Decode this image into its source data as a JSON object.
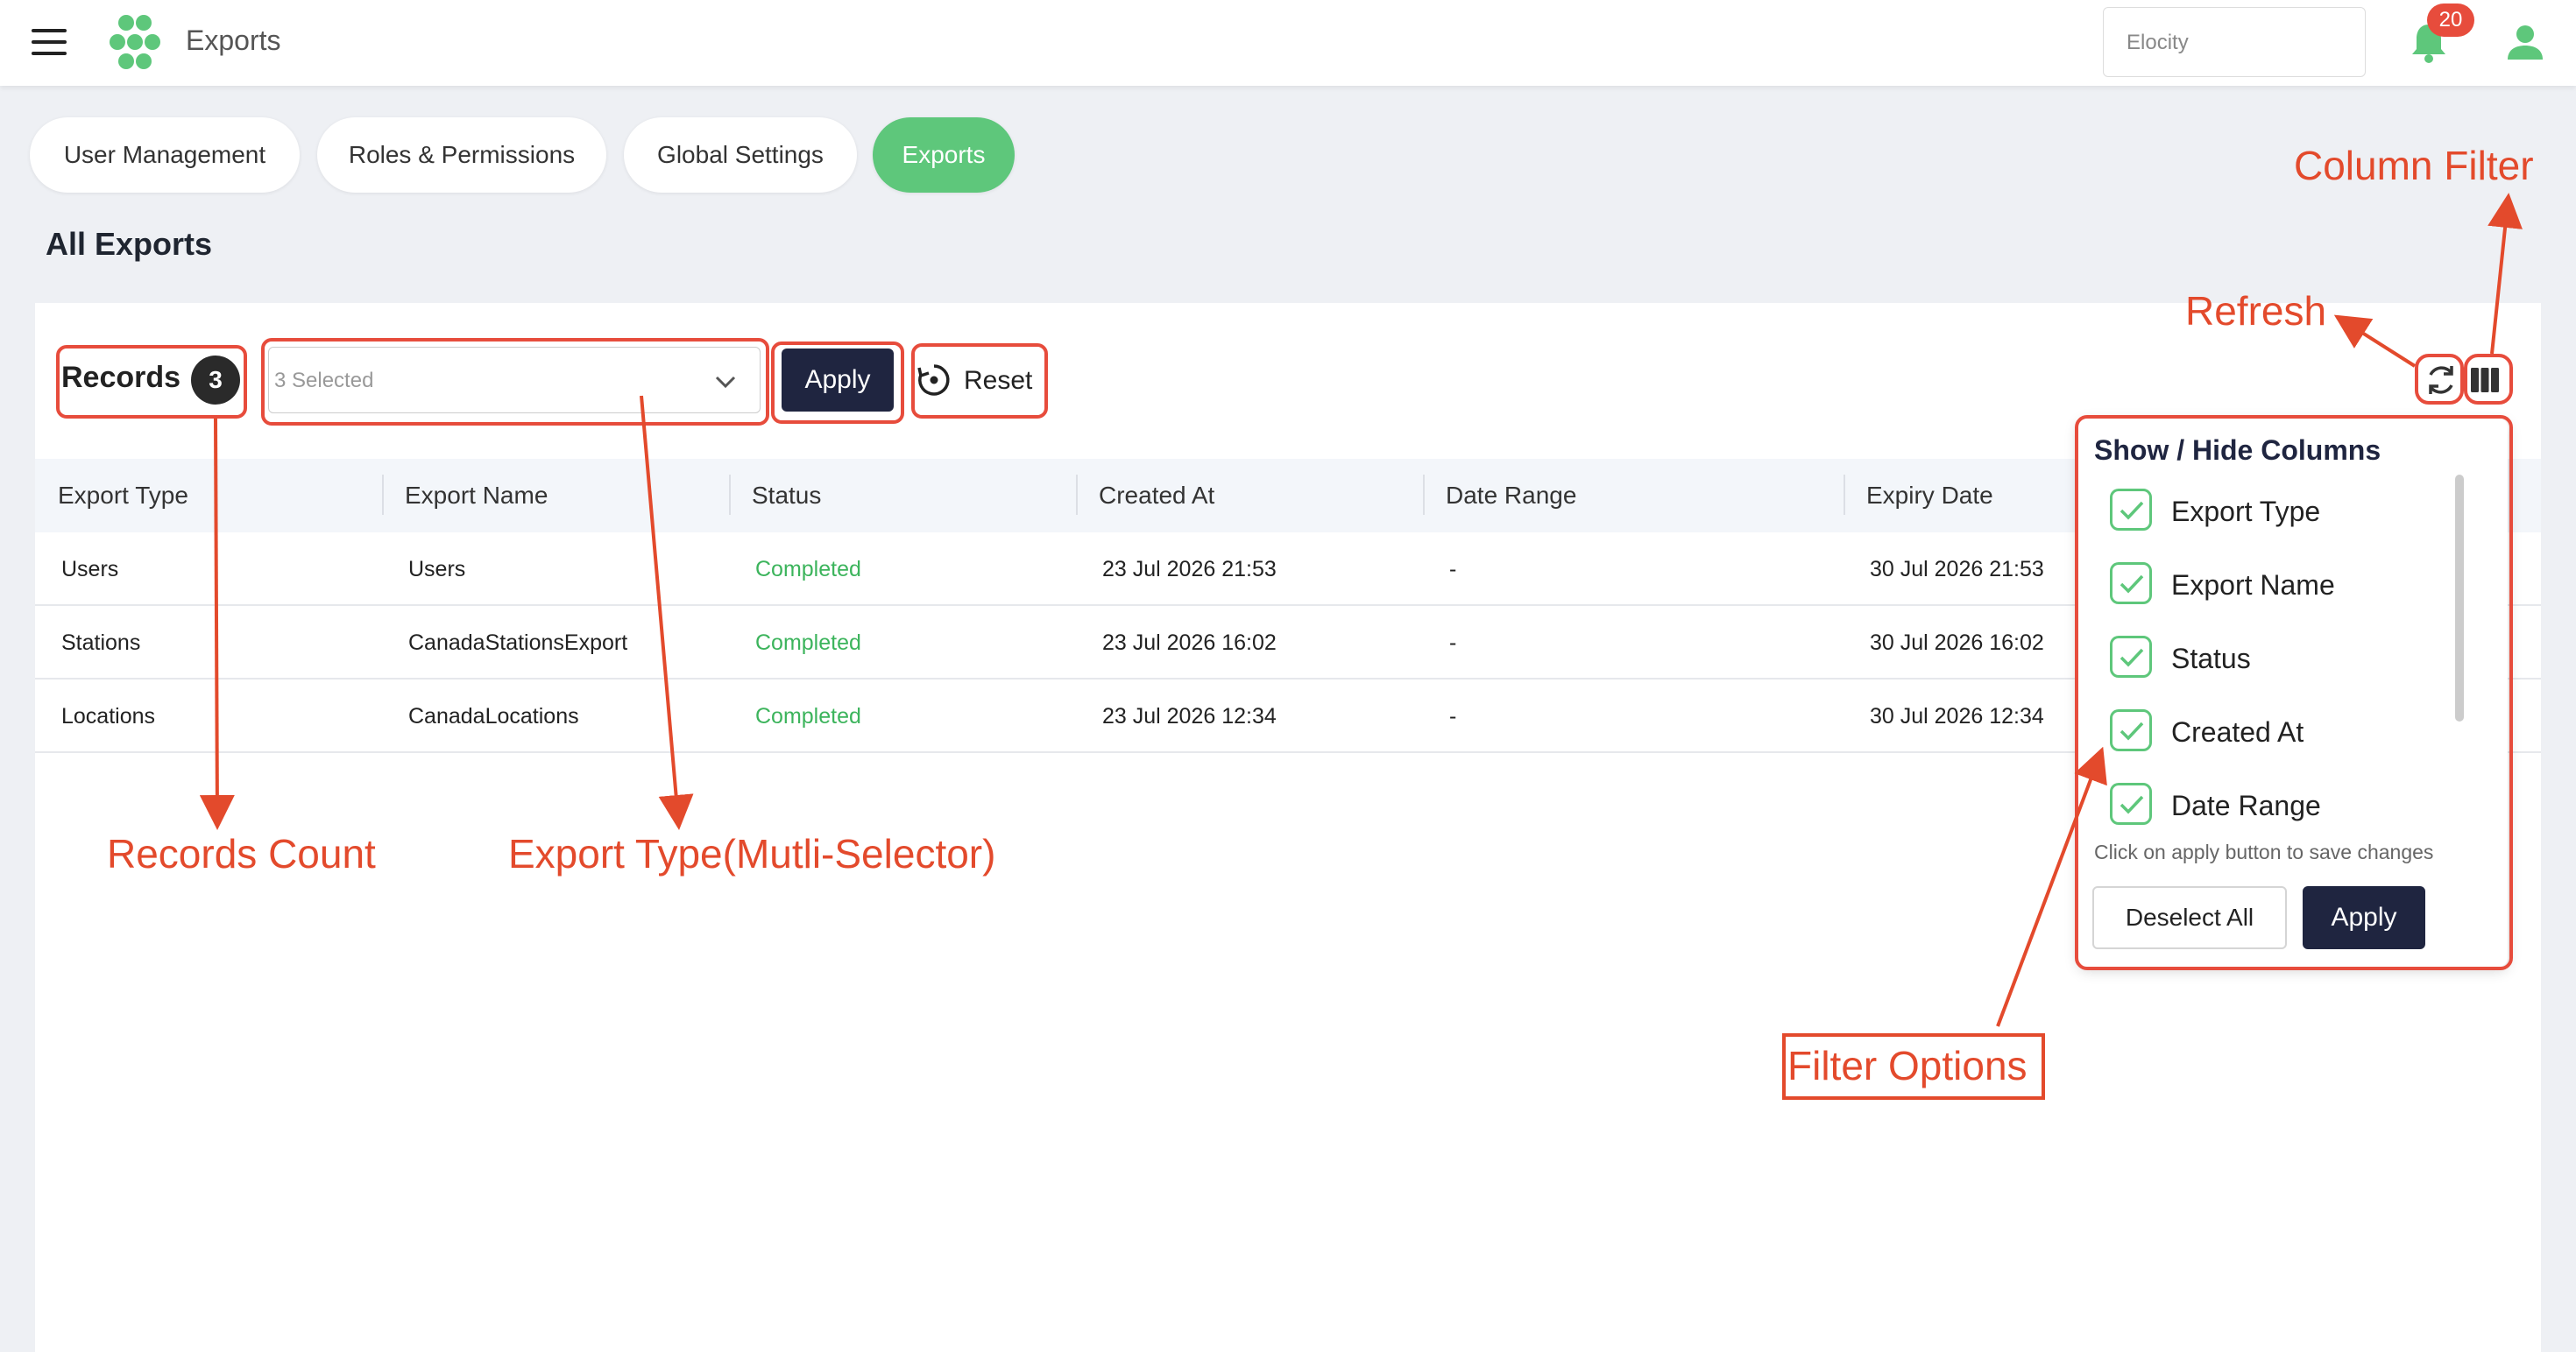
{
  "header": {
    "app_title": "Exports",
    "org_placeholder": "Elocity",
    "notification_count": "20"
  },
  "tabs": [
    {
      "label": "User Management"
    },
    {
      "label": "Roles & Permissions"
    },
    {
      "label": "Global Settings"
    },
    {
      "label": "Exports",
      "active": true
    }
  ],
  "page_title": "All Exports",
  "toolbar": {
    "records_label": "Records",
    "records_count": "3",
    "type_select_value": "3 Selected",
    "apply_label": "Apply",
    "reset_label": "Reset"
  },
  "table": {
    "columns": [
      "Export Type",
      "Export Name",
      "Status",
      "Created At",
      "Date Range",
      "Expiry Date"
    ],
    "rows": [
      {
        "type": "Users",
        "name": "Users",
        "status": "Completed",
        "created": "23 Jul 2026 21:53",
        "range": "-",
        "expiry": "30 Jul 2026 21:53"
      },
      {
        "type": "Stations",
        "name": "CanadaStationsExport",
        "status": "Completed",
        "created": "23 Jul 2026 16:02",
        "range": "-",
        "expiry": "30 Jul 2026 16:02"
      },
      {
        "type": "Locations",
        "name": "CanadaLocations",
        "status": "Completed",
        "created": "23 Jul 2026 12:34",
        "range": "-",
        "expiry": "30 Jul 2026 12:34"
      }
    ]
  },
  "column_popup": {
    "title": "Show / Hide Columns",
    "items": [
      "Export Type",
      "Export Name",
      "Status",
      "Created At",
      "Date Range"
    ],
    "hint": "Click on apply button to save changes",
    "deselect_label": "Deselect All",
    "apply_label": "Apply"
  },
  "annotations": {
    "column_filter": "Column Filter",
    "refresh": "Refresh",
    "records_count": "Records Count",
    "export_type": "Export Type(Mutli-Selector)",
    "filter_options": "Filter Options"
  },
  "colors": {
    "accent_green": "#5ec77b",
    "dark_button": "#1f2540",
    "annotation_red": "#e34a2c",
    "badge_red": "#e74c3c"
  },
  "icons": [
    "menu-icon",
    "logo-icon",
    "bell-icon",
    "user-icon",
    "chevron-down-icon",
    "reset-icon",
    "refresh-icon",
    "columns-icon",
    "check-icon"
  ]
}
